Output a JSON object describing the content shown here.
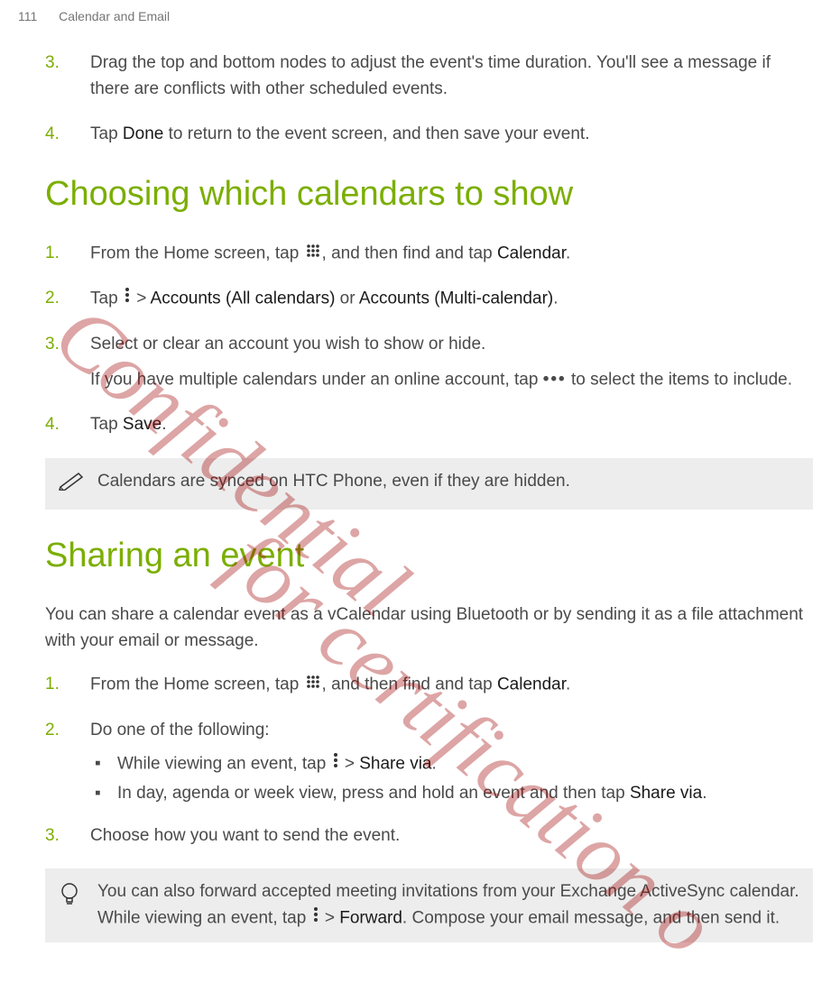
{
  "header": {
    "page": "111",
    "section": "Calendar and Email"
  },
  "section1": {
    "step3_num": "3.",
    "step3": "Drag the top and bottom nodes to adjust the event's time duration. You'll see a message if there are conflicts with other scheduled events.",
    "step4_num": "4.",
    "step4_a": "Tap ",
    "step4_b": "Done",
    "step4_c": " to return to the event screen, and then save your event."
  },
  "section2": {
    "heading": "Choosing which calendars to show",
    "s1_num": "1.",
    "s1_a": "From the Home screen, tap ",
    "s1_b": ", and then find and tap ",
    "s1_c": "Calendar",
    "s1_d": ".",
    "s2_num": "2.",
    "s2_a": "Tap ",
    "s2_b": " > ",
    "s2_c": "Accounts (All calendars)",
    "s2_d": " or ",
    "s2_e": "Accounts (Multi-calendar)",
    "s2_f": ".",
    "s3_num": "3.",
    "s3_a": "Select or clear an account you wish to show or hide.",
    "s3_b": "If you have multiple calendars under an online account, tap ",
    "s3_c": " to select the items to include.",
    "s4_num": "4.",
    "s4_a": "Tap ",
    "s4_b": "Save",
    "s4_c": ".",
    "note": "Calendars are synced on HTC Phone, even if they are hidden."
  },
  "section3": {
    "heading": "Sharing an event",
    "intro": "You can share a calendar event as a vCalendar using Bluetooth or by sending it as a file attachment with your email or message.",
    "s1_num": "1.",
    "s1_a": "From the Home screen, tap ",
    "s1_b": ", and then find and tap ",
    "s1_c": "Calendar",
    "s1_d": ".",
    "s2_num": "2.",
    "s2_a": "Do one of the following:",
    "b1_a": "While viewing an event, tap ",
    "b1_b": " > ",
    "b1_c": "Share via",
    "b1_d": ".",
    "b2_a": "In day, agenda or week view, press and hold an event and then tap ",
    "b2_b": "Share via",
    "b2_c": ".",
    "s3_num": "3.",
    "s3_a": "Choose how you want to send the event.",
    "note_a": "You can also forward accepted meeting invitations from your Exchange ActiveSync calendar. While viewing an event, tap ",
    "note_b": " > ",
    "note_c": "Forward",
    "note_d": ". Compose your email message, and then send it."
  },
  "watermarks": {
    "w1": "Confidential",
    "w2": "for certification o"
  }
}
